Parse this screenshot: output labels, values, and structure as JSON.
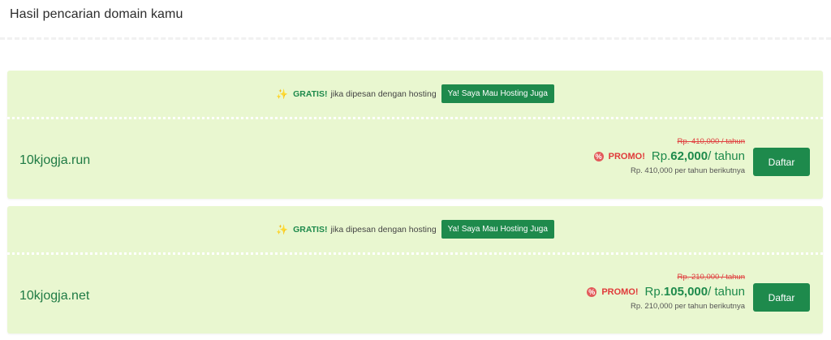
{
  "page": {
    "title": "Hasil pencarian domain kamu"
  },
  "colors": {
    "accent": "#1e8a4c",
    "card_bg": "#e9f7d0",
    "promo_red": "#e03a3a"
  },
  "results": [
    {
      "promo": {
        "icon": "sparkle-icon",
        "gratis_label": "GRATIS!",
        "text": "jika dipesan dengan hosting",
        "button_label": "Ya! Saya Mau Hosting Juga"
      },
      "domain": "10kjogja.run",
      "old_price": "Rp. 410,000 / tahun",
      "promo_label": "PROMO!",
      "price_prefix": "Rp.",
      "price_amount": "62,000",
      "price_unit": "/ tahun",
      "renew_text": "Rp. 410,000 per tahun berikutnya",
      "button_label": "Daftar"
    },
    {
      "promo": {
        "icon": "sparkle-icon",
        "gratis_label": "GRATIS!",
        "text": "jika dipesan dengan hosting",
        "button_label": "Ya! Saya Mau Hosting Juga"
      },
      "domain": "10kjogja.net",
      "old_price": "Rp. 210,000 / tahun",
      "promo_label": "PROMO!",
      "price_prefix": "Rp.",
      "price_amount": "105,000",
      "price_unit": "/ tahun",
      "renew_text": "Rp. 210,000 per tahun berikutnya",
      "button_label": "Daftar"
    }
  ]
}
